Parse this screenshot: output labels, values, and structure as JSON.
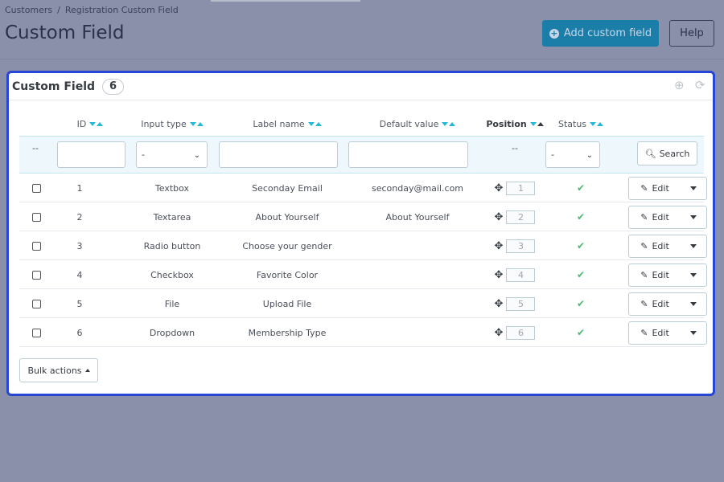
{
  "breadcrumb": {
    "parent": "Customers",
    "separator": "/",
    "current": "Registration Custom Field"
  },
  "page": {
    "title": "Custom Field"
  },
  "toolbar": {
    "add_label": "Add custom field",
    "help_label": "Help"
  },
  "panel": {
    "title": "Custom Field",
    "count": "6"
  },
  "table": {
    "headers": {
      "id": "ID",
      "input_type": "Input type",
      "label_name": "Label name",
      "default_value": "Default value",
      "position": "Position",
      "status": "Status"
    },
    "filters": {
      "id_placeholder": "--",
      "input_type_value": "-",
      "position_placeholder": "--",
      "status_value": "-",
      "search_label": "Search"
    },
    "rows": [
      {
        "id": "1",
        "input_type": "Textbox",
        "label_name": "Seconday Email",
        "default_value": "seconday@mail.com",
        "position": "1",
        "edit_label": "Edit"
      },
      {
        "id": "2",
        "input_type": "Textarea",
        "label_name": "About Yourself",
        "default_value": "About Yourself",
        "position": "2",
        "edit_label": "Edit"
      },
      {
        "id": "3",
        "input_type": "Radio button",
        "label_name": "Choose your gender",
        "default_value": "",
        "position": "3",
        "edit_label": "Edit"
      },
      {
        "id": "4",
        "input_type": "Checkbox",
        "label_name": "Favorite Color",
        "default_value": "",
        "position": "4",
        "edit_label": "Edit"
      },
      {
        "id": "5",
        "input_type": "File",
        "label_name": "Upload File",
        "default_value": "",
        "position": "5",
        "edit_label": "Edit"
      },
      {
        "id": "6",
        "input_type": "Dropdown",
        "label_name": "Membership Type",
        "default_value": "",
        "position": "6",
        "edit_label": "Edit"
      }
    ]
  },
  "bulk": {
    "label": "Bulk actions"
  },
  "colors": {
    "accent": "#25b9d7",
    "primary_button": "#1b7ea8",
    "panel_border": "#2746d6",
    "status_ok": "#4cbb6c"
  }
}
